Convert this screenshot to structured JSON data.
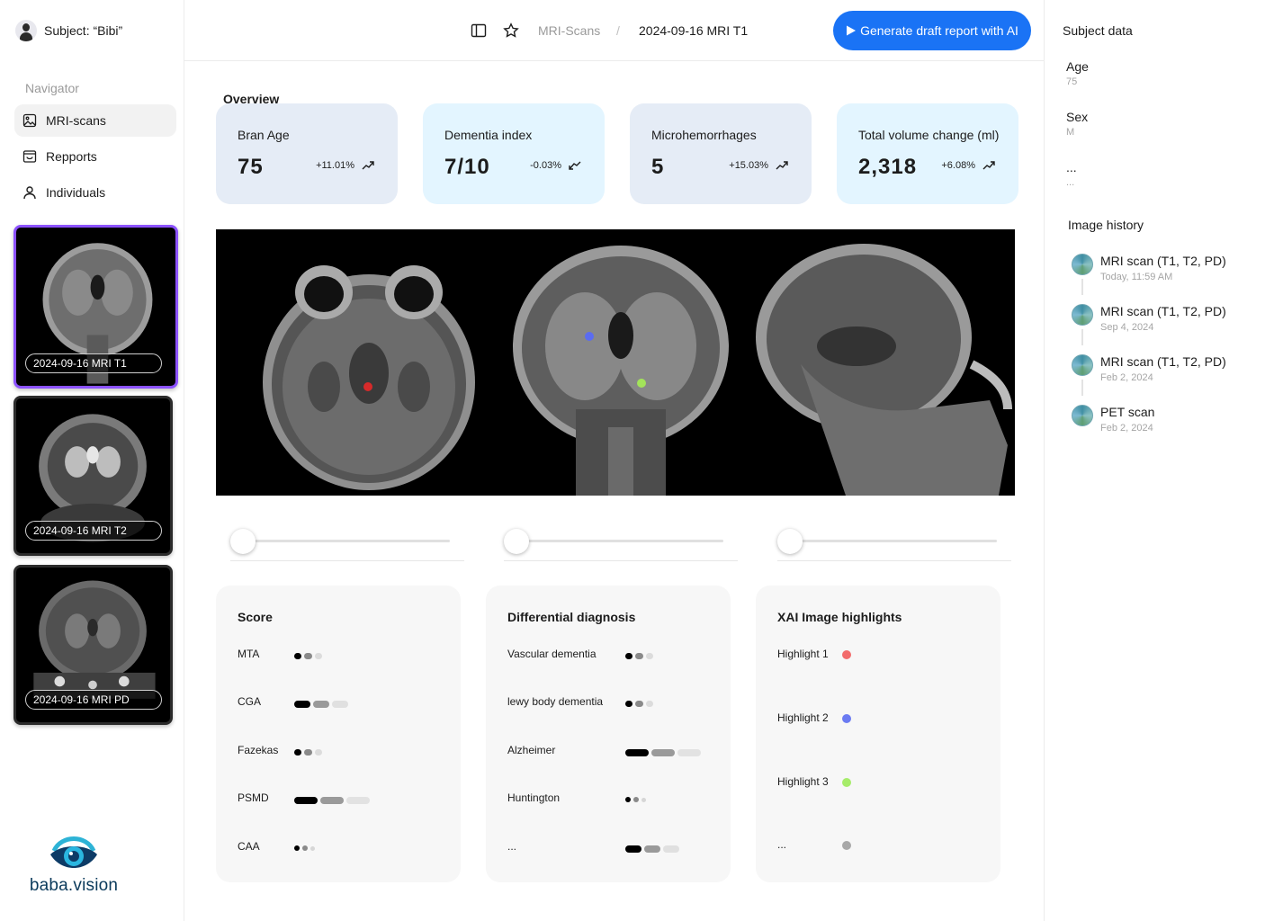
{
  "subject": {
    "label": "Subject: “Bibi”"
  },
  "navigator": {
    "title": "Navigator",
    "items": [
      {
        "label": "MRI-scans",
        "icon": "image-icon",
        "active": true
      },
      {
        "label": "Repports",
        "icon": "inbox-icon",
        "active": false
      },
      {
        "label": "Individuals",
        "icon": "user-icon",
        "active": false
      }
    ]
  },
  "scans": [
    {
      "label": "2024-09-16 MRI T1",
      "active": true
    },
    {
      "label": "2024-09-16 MRI T2",
      "active": false
    },
    {
      "label": "2024-09-16 MRI PD",
      "active": false
    }
  ],
  "logo": {
    "text": "baba.vision"
  },
  "header": {
    "breadcrumb": [
      "MRI-Scans",
      "2024-09-16 MRI T1"
    ],
    "separator": "/",
    "ai_button": "Generate draft report with AI"
  },
  "overview": {
    "title": "Overview",
    "kpis": [
      {
        "label": "Bran Age",
        "value": "75",
        "delta": "+11.01%",
        "trend": "up"
      },
      {
        "label": "Dementia index",
        "value": "7/10",
        "delta": "-0.03%",
        "trend": "down"
      },
      {
        "label": "Microhemorrhages",
        "value": "5",
        "delta": "+15.03%",
        "trend": "up"
      },
      {
        "label": "Total volume change (ml)",
        "value": "2,318",
        "delta": "+6.08%",
        "trend": "up"
      }
    ]
  },
  "viewer": {
    "markers": [
      {
        "view": "axial",
        "color": "#d62a2a"
      },
      {
        "view": "coronal",
        "color": "#5b6cf0"
      },
      {
        "view": "coronal",
        "color": "#a3e35a"
      }
    ],
    "sliders": [
      0.0,
      0.0,
      0.0
    ]
  },
  "score": {
    "title": "Score",
    "rows": [
      {
        "label": "MTA",
        "style": "small"
      },
      {
        "label": "CGA",
        "style": "medium"
      },
      {
        "label": "Fazekas",
        "style": "small"
      },
      {
        "label": "PSMD",
        "style": "large"
      },
      {
        "label": "CAA",
        "style": "tiny"
      }
    ]
  },
  "diagnosis": {
    "title": "Differential diagnosis",
    "rows": [
      {
        "label": "Vascular dementia",
        "style": "small"
      },
      {
        "label": "lewy body dementia",
        "style": "small"
      },
      {
        "label": "Alzheimer",
        "style": "large"
      },
      {
        "label": "Huntington",
        "style": "tiny"
      },
      {
        "label": "...",
        "style": "medium"
      }
    ]
  },
  "xai": {
    "title": "XAI Image highlights",
    "rows": [
      {
        "label": "Highlight 1",
        "color": "#f26b6b"
      },
      {
        "label": "Highlight 2",
        "color": "#6b7bf2"
      },
      {
        "label": "Highlight 3",
        "color": "#a6ec6a"
      },
      {
        "label": "...",
        "color": "#a8a8a8"
      }
    ]
  },
  "subject_data": {
    "title": "Subject data",
    "fields": [
      {
        "label": "Age",
        "value": "75"
      },
      {
        "label": "Sex",
        "value": "M"
      },
      {
        "label": "...",
        "value": "..."
      }
    ]
  },
  "image_history": {
    "title": "Image history",
    "items": [
      {
        "name": "MRI scan (T1, T2, PD)",
        "time": "Today, 11:59 AM"
      },
      {
        "name": "MRI scan (T1, T2, PD)",
        "time": "Sep 4, 2024"
      },
      {
        "name": "MRI scan (T1, T2, PD)",
        "time": "Feb 2, 2024"
      },
      {
        "name": "PET scan",
        "time": "Feb 2, 2024"
      }
    ]
  }
}
